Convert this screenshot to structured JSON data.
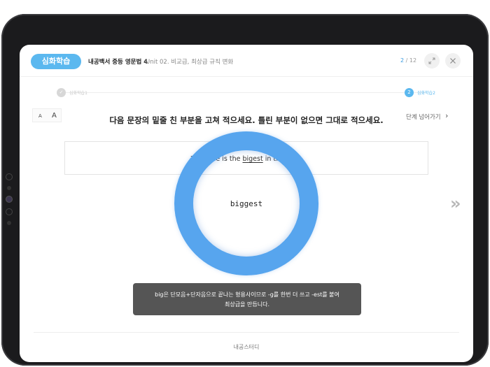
{
  "header": {
    "badge": "심화학습",
    "book_title": "내공백서 중등 영문법 4",
    "unit_title": "Unit 02. 비교급, 최상급 규칙 변화",
    "page_current": "2",
    "page_total": "/ 12",
    "icons": [
      "expand-icon",
      "close-icon"
    ]
  },
  "progress": {
    "step1_label": "심화학습1",
    "step2_number": "2",
    "step2_label": "심화학습2"
  },
  "controls": {
    "font_small": "A",
    "font_large": "A",
    "skip_label": "단계 넘어가기",
    "skip_arrow": "›"
  },
  "question": {
    "instruction": "다음 문장의 밑줄 친 부분을 고쳐 적으세요. 틀린 부분이 없으면 그대로 적으세요.",
    "sentence_before": "This tree is the ",
    "sentence_error": "bigest",
    "sentence_after": " in the park."
  },
  "answer": {
    "text": "biggest"
  },
  "tooltip": {
    "line1": "big은 단모음+단자음으로 끝나는 형용사이므로 -g를 한번 더 쓰고 -est를 붙여",
    "line2": "최상급을 만듭니다."
  },
  "footer": {
    "brand": "내공스터디"
  },
  "colors": {
    "accent": "#5bb8ef",
    "ring": "#57a5ee",
    "tooltip_bg": "#555555"
  }
}
